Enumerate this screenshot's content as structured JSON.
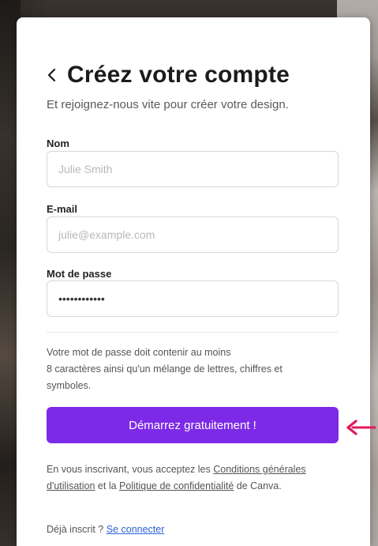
{
  "title": "Créez votre compte",
  "subtitle": "Et rejoignez-nous vite pour créer votre design.",
  "fields": {
    "name": {
      "label": "Nom",
      "placeholder": "Julie Smith",
      "value": ""
    },
    "email": {
      "label": "E-mail",
      "placeholder": "julie@example.com",
      "value": ""
    },
    "password": {
      "label": "Mot de passe",
      "placeholder": "",
      "value": "************"
    }
  },
  "password_hint_lines": [
    "Votre mot de passe doit contenir au moins",
    "8 caractères ainsi qu'un mélange de lettres, chiffres et",
    "symboles."
  ],
  "cta_label": "Démarrez gratuitement !",
  "terms": {
    "prefix": "En vous inscrivant, vous acceptez les ",
    "conditions_link": "Conditions générales d'utilisation",
    "middle": " et la ",
    "policy_link": "Politique de confidentialité",
    "suffix": " de Canva."
  },
  "login": {
    "prefix": "Déjà inscrit ? ",
    "link": "Se connecter"
  },
  "colors": {
    "accent": "#7d2ae8",
    "link": "#2b62d6",
    "annotation_arrow": "#e0195a"
  },
  "icons": {
    "back": "chevron-left-icon",
    "annotation": "arrow-left-icon"
  }
}
